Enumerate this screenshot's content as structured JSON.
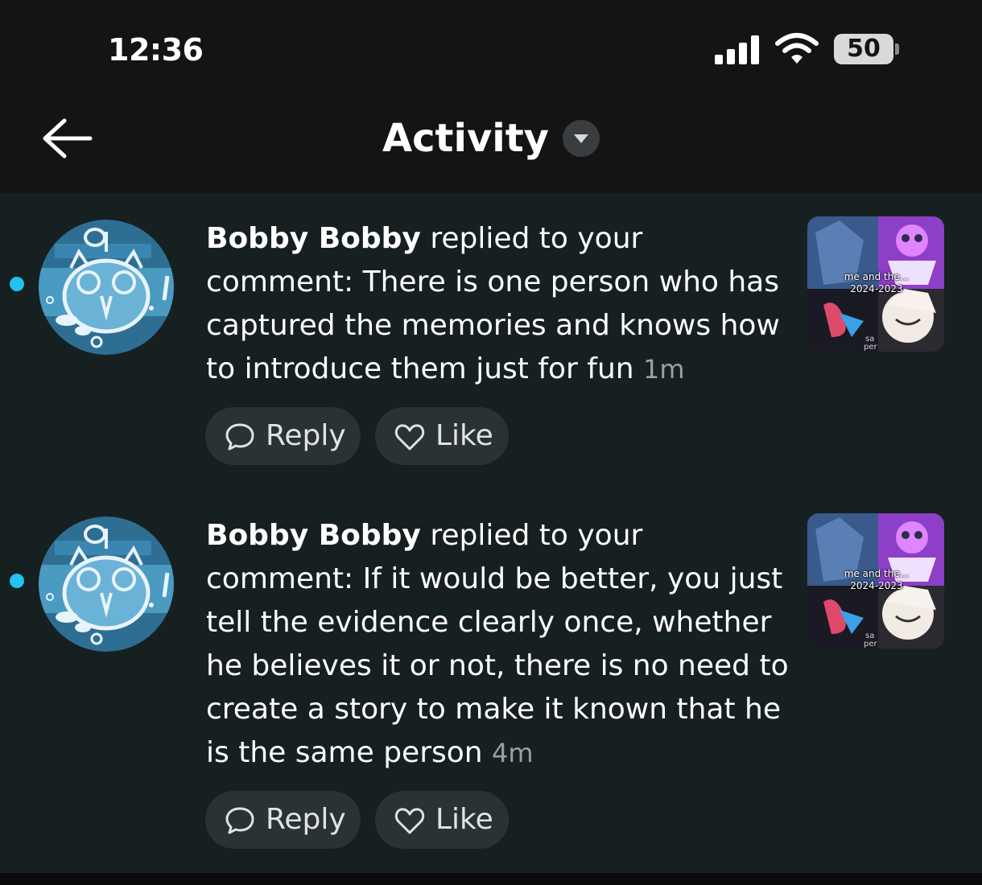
{
  "status_bar": {
    "time": "12:36",
    "battery": "50"
  },
  "header": {
    "title": "Activity"
  },
  "notifications": [
    {
      "name": "Bobby Bobby",
      "message": " replied to your comment: There is one person who has captured the memories and knows how to introduce them just for fun ",
      "time": "1m",
      "thumbnail_caption": "me and the... 2024-2023",
      "reply_label": "Reply",
      "like_label": "Like"
    },
    {
      "name": "Bobby Bobby",
      "message": " replied to your comment: If it would be better, you just tell the evidence clearly once, whether he believes it or not, there is no need to create a story to make it known that he is the same person ",
      "time": "4m",
      "thumbnail_caption": "me and the... 2024-2023",
      "reply_label": "Reply",
      "like_label": "Like"
    }
  ],
  "colors": {
    "unread_dot": "#23c2f0",
    "background": "#172021",
    "pill": "#2a3234"
  }
}
